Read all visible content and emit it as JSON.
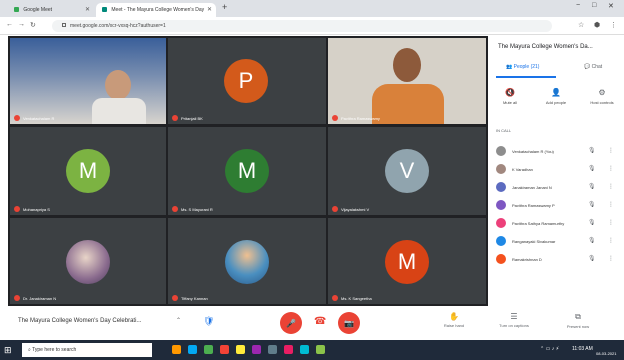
{
  "browser": {
    "tabs": [
      {
        "label": "Google Meet",
        "active": false
      },
      {
        "label": "Meet - The Mayura College Women's Day",
        "active": true
      }
    ],
    "new_tab": "+",
    "address": "meet.google.com/xcr-vxsq-hcz?authuser=1",
    "window_controls": [
      "−",
      "□",
      "✕"
    ]
  },
  "tiles": [
    {
      "name": "Venkatachalam R",
      "avatar": null,
      "photo": "man"
    },
    {
      "name": "Pritanjali BK",
      "avatar": "P",
      "color": "#d35a1b"
    },
    {
      "name": "Pavithra Ramaswamy",
      "avatar": null,
      "photo": "woman"
    },
    {
      "name": "Mohanapriya S",
      "avatar": "M",
      "color": "#7cb342"
    },
    {
      "name": "Ms. S Mayurani R",
      "avatar": "M",
      "color": "#2e7d32"
    },
    {
      "name": "Vijayalakshmi V",
      "avatar": "V",
      "color": "#90a4ae"
    },
    {
      "name": "Dr. Janakiraman N",
      "avatar": null,
      "photo": "group"
    },
    {
      "name": "Tiffany Kannan",
      "avatar": null,
      "photo": "child"
    },
    {
      "name": "Ms. K Sangeetha",
      "avatar": "M",
      "color": "#d84315"
    }
  ],
  "sidebar": {
    "title": "The Mayura College Women's Da...",
    "tabs": [
      {
        "label": "People (21)",
        "active": true
      },
      {
        "label": "Chat",
        "active": false
      }
    ],
    "actions": [
      {
        "label": "Mute all",
        "icon": "🔇"
      },
      {
        "label": "Add people",
        "icon": "👤"
      },
      {
        "label": "Host controls",
        "icon": "⚙"
      }
    ],
    "section_label": "IN CALL",
    "people": [
      {
        "name": "Venkatachalam R (You)",
        "color": "#8d8d8d"
      },
      {
        "name": "K Varadhan",
        "color": "#a1887f"
      },
      {
        "name": "Janakiraman Janani N",
        "color": "#5c6bc0"
      },
      {
        "name": "Pavithra Ramaswamy P",
        "color": "#7e57c2"
      },
      {
        "name": "Pavithra Sathya Ramamurthy",
        "color": "#ec407a"
      },
      {
        "name": "Ranganayaki Sivakumar",
        "color": "#1e88e5"
      },
      {
        "name": "Ramakrishnan D",
        "color": "#f4511e"
      }
    ]
  },
  "controls": {
    "meeting_title": "The Mayura College Women's Day Celebrati...",
    "chevron": "⌃",
    "shield": "🛡",
    "mic_off": "🎤",
    "end_call": "☎",
    "cam_off": "📷",
    "buttons": [
      {
        "label": "Raise hand",
        "icon": "✋"
      },
      {
        "label": "Turn on captions",
        "icon": "☰"
      },
      {
        "label": "Present now",
        "icon": "⧉"
      }
    ]
  },
  "taskbar": {
    "search_placeholder": "Type here to search",
    "clock": "11:03 AM",
    "date": "08-03-2021",
    "apps": [
      "#ff9800",
      "#03a9f4",
      "#4caf50",
      "#f44336",
      "#ffeb3b",
      "#9c27b0",
      "#607d8b",
      "#e91e63",
      "#00bcd4",
      "#8bc34a"
    ]
  }
}
